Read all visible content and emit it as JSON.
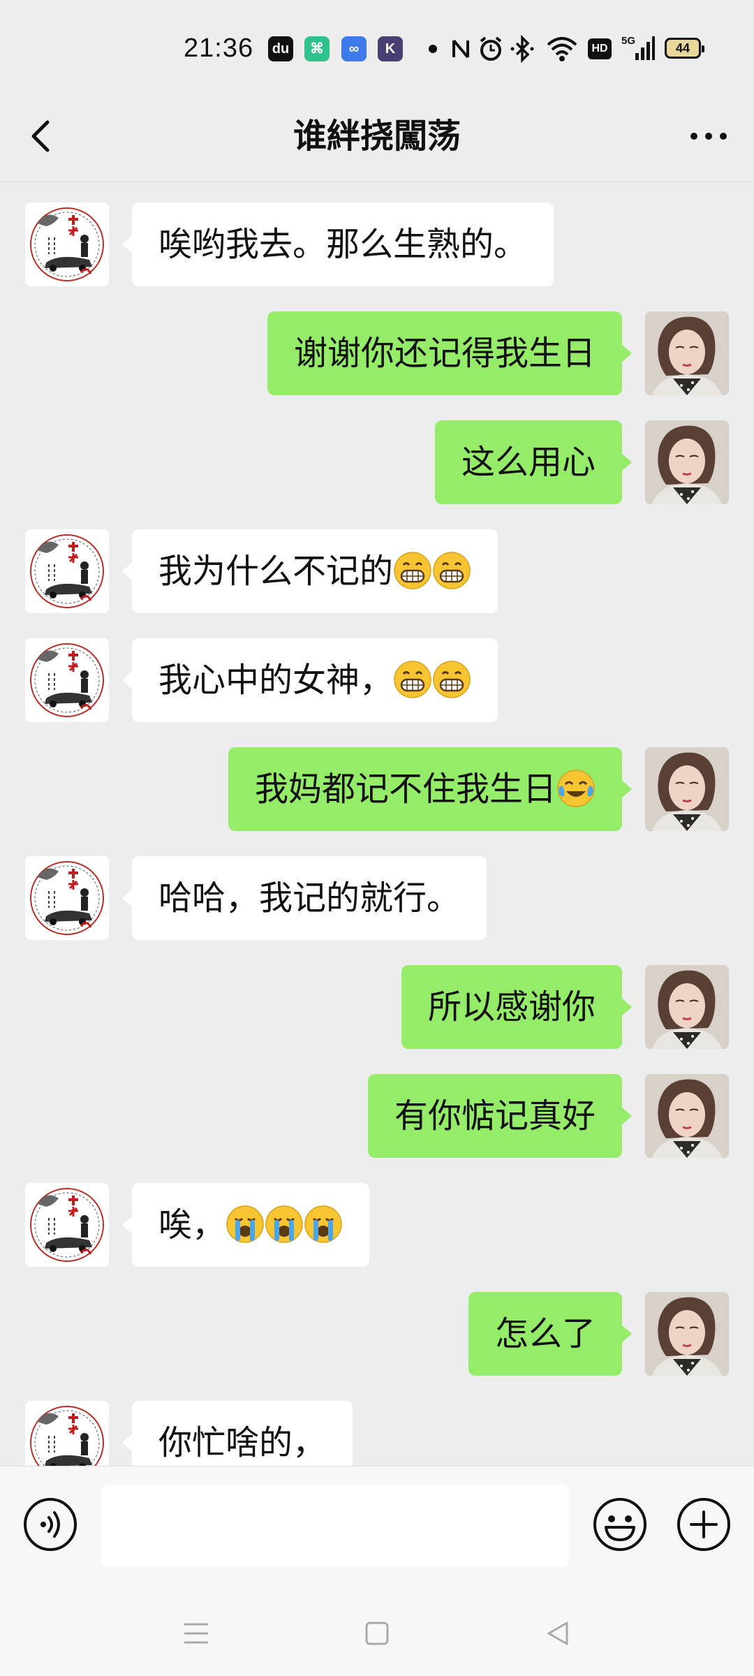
{
  "status_bar": {
    "time": "21:36",
    "app_icons": [
      {
        "name": "dewu-app-icon",
        "glyph": "du",
        "color": "#111111"
      },
      {
        "name": "green-app-icon",
        "glyph": "⌘",
        "color": "#2fc28d"
      },
      {
        "name": "infinity-app-icon",
        "glyph": "∞",
        "color": "#3d7bea"
      },
      {
        "name": "k-app-icon",
        "glyph": "K",
        "color": "#4a3f73"
      }
    ],
    "battery": "44",
    "network": "5G",
    "hd": "HD"
  },
  "header": {
    "title": "谁絆挠闖荡",
    "back_icon": "chevron-left-icon",
    "more_icon": "more-dots-icon"
  },
  "messages": [
    {
      "side": "left",
      "text": "唉哟我去。那么生熟的。",
      "emoji": []
    },
    {
      "side": "right",
      "text": "谢谢你还记得我生日",
      "emoji": []
    },
    {
      "side": "right",
      "text": "这么用心",
      "emoji": []
    },
    {
      "side": "left",
      "text": "我为什么不记的",
      "emoji": [
        "grin",
        "grin"
      ]
    },
    {
      "side": "left",
      "text": "我心中的女神，",
      "emoji": [
        "grin",
        "grin"
      ]
    },
    {
      "side": "right",
      "text": "我妈都记不住我生日",
      "emoji": [
        "tears-of-joy"
      ]
    },
    {
      "side": "left",
      "text": "哈哈，我记的就行。",
      "emoji": []
    },
    {
      "side": "right",
      "text": "所以感谢你",
      "emoji": []
    },
    {
      "side": "right",
      "text": "有你惦记真好",
      "emoji": []
    },
    {
      "side": "left",
      "text": "唉，",
      "emoji": [
        "loud-cry",
        "loud-cry",
        "loud-cry"
      ]
    },
    {
      "side": "right",
      "text": "怎么了",
      "emoji": []
    },
    {
      "side": "left",
      "text": "你忙啥的，",
      "emoji": []
    }
  ],
  "input_bar": {
    "text_value": "",
    "voice_icon": "voice-input-icon",
    "emoji_icon": "emoji-smile-icon",
    "plus_icon": "plus-circle-icon"
  },
  "colors": {
    "background": "#ededed",
    "sent_bubble": "#95ec69",
    "received_bubble": "#ffffff"
  }
}
